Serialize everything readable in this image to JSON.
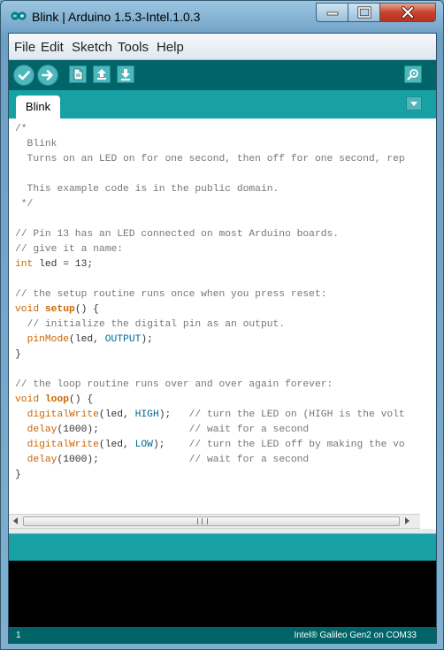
{
  "window": {
    "title": "Blink | Arduino 1.5.3-Intel.1.0.3",
    "app_icon": "arduino-infinity-icon",
    "controls": [
      "minimize-icon",
      "maximize-icon",
      "close-icon"
    ]
  },
  "menubar": {
    "items": [
      "File",
      "Edit",
      "Sketch",
      "Tools",
      "Help"
    ]
  },
  "toolbar": {
    "buttons": [
      {
        "icon": "verify-check-icon"
      },
      {
        "icon": "upload-arrow-icon"
      },
      {
        "icon": "new-file-icon"
      },
      {
        "icon": "open-up-arrow-icon"
      },
      {
        "icon": "save-down-arrow-icon"
      },
      {
        "icon": "serial-monitor-magnifier-icon"
      }
    ]
  },
  "tabs": {
    "items": [
      "Blink"
    ],
    "menu_icon": "tab-menu-down-arrow-icon"
  },
  "editor": {
    "lines": [
      [
        [
          "cm",
          "/*"
        ]
      ],
      [
        [
          "cm",
          "  Blink"
        ]
      ],
      [
        [
          "cm",
          "  Turns on an LED on for one second, then off for one second, rep"
        ]
      ],
      [
        [
          "cm",
          ""
        ]
      ],
      [
        [
          "cm",
          "  This example code is in the public domain."
        ]
      ],
      [
        [
          "cm",
          " */"
        ]
      ],
      [
        [
          "",
          ""
        ]
      ],
      [
        [
          "cm",
          "// Pin 13 has an LED connected on most Arduino boards."
        ]
      ],
      [
        [
          "cm",
          "// give it a name:"
        ]
      ],
      [
        [
          "kw",
          "int"
        ],
        [
          "",
          " led = 13;"
        ]
      ],
      [
        [
          "",
          ""
        ]
      ],
      [
        [
          "cm",
          "// the setup routine runs once when you press reset:"
        ]
      ],
      [
        [
          "kw",
          "void"
        ],
        [
          "",
          " "
        ],
        [
          "kwb",
          "setup"
        ],
        [
          "",
          "() {"
        ]
      ],
      [
        [
          "cm",
          "  // initialize the digital pin as an output."
        ]
      ],
      [
        [
          "",
          "  "
        ],
        [
          "kw",
          "pinMode"
        ],
        [
          "",
          "(led, "
        ],
        [
          "cst",
          "OUTPUT"
        ],
        [
          "",
          ");"
        ]
      ],
      [
        [
          "",
          "}"
        ]
      ],
      [
        [
          "",
          ""
        ]
      ],
      [
        [
          "cm",
          "// the loop routine runs over and over again forever:"
        ]
      ],
      [
        [
          "kw",
          "void"
        ],
        [
          "",
          " "
        ],
        [
          "kwb",
          "loop"
        ],
        [
          "",
          "() {"
        ]
      ],
      [
        [
          "",
          "  "
        ],
        [
          "kw",
          "digitalWrite"
        ],
        [
          "",
          "(led, "
        ],
        [
          "cst",
          "HIGH"
        ],
        [
          "",
          ");   "
        ],
        [
          "cm",
          "// turn the LED on (HIGH is the volt"
        ]
      ],
      [
        [
          "",
          "  "
        ],
        [
          "kw",
          "delay"
        ],
        [
          "",
          "(1000);               "
        ],
        [
          "cm",
          "// wait for a second"
        ]
      ],
      [
        [
          "",
          "  "
        ],
        [
          "kw",
          "digitalWrite"
        ],
        [
          "",
          "(led, "
        ],
        [
          "cst",
          "LOW"
        ],
        [
          "",
          ");    "
        ],
        [
          "cm",
          "// turn the LED off by making the vo"
        ]
      ],
      [
        [
          "",
          "  "
        ],
        [
          "kw",
          "delay"
        ],
        [
          "",
          "(1000);               "
        ],
        [
          "cm",
          "// wait for a second"
        ]
      ],
      [
        [
          "",
          "}"
        ]
      ]
    ]
  },
  "status": {
    "line": "1",
    "board": "Intel® Galileo Gen2 on COM33"
  },
  "colors": {
    "toolbar_bg": "#006468",
    "tab_strip_bg": "#17a1a5",
    "button_fill": "#4db7bb",
    "keyword": "#cc6600",
    "constant": "#006699",
    "comment": "#777777",
    "console_bg": "#000000"
  }
}
